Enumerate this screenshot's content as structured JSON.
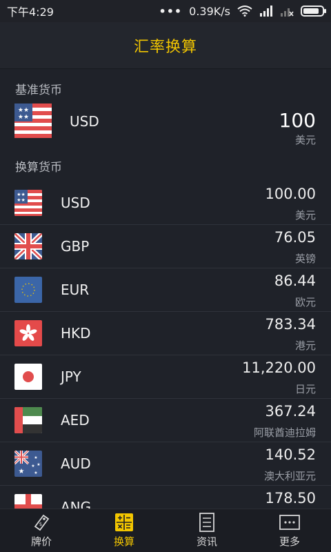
{
  "status": {
    "time": "下午4:29",
    "speed": "0.39K/s"
  },
  "header": {
    "title": "汇率换算"
  },
  "base": {
    "section_label": "基准货币",
    "code": "USD",
    "value": "100",
    "unit": "美元",
    "flag_icon": "us-flag-icon"
  },
  "convert_label": "换算货币",
  "rates": [
    {
      "code": "USD",
      "value": "100.00",
      "unit": "美元",
      "flag_icon": "us-flag-icon"
    },
    {
      "code": "GBP",
      "value": "76.05",
      "unit": "英镑",
      "flag_icon": "uk-flag-icon"
    },
    {
      "code": "EUR",
      "value": "86.44",
      "unit": "欧元",
      "flag_icon": "eu-flag-icon"
    },
    {
      "code": "HKD",
      "value": "783.34",
      "unit": "港元",
      "flag_icon": "hk-flag-icon"
    },
    {
      "code": "JPY",
      "value": "11,220.00",
      "unit": "日元",
      "flag_icon": "jp-flag-icon"
    },
    {
      "code": "AED",
      "value": "367.24",
      "unit": "阿联酋迪拉姆",
      "flag_icon": "ae-flag-icon"
    },
    {
      "code": "AUD",
      "value": "140.52",
      "unit": "澳大利亚元",
      "flag_icon": "au-flag-icon"
    },
    {
      "code": "ANG",
      "value": "178.50",
      "unit": "",
      "flag_icon": "ang-flag-icon"
    }
  ],
  "tabs": [
    {
      "label": "牌价",
      "icon": "price-tag-icon"
    },
    {
      "label": "换算",
      "icon": "calculator-icon",
      "active": true
    },
    {
      "label": "资讯",
      "icon": "news-icon"
    },
    {
      "label": "更多",
      "icon": "more-icon"
    }
  ],
  "colors": {
    "accent": "#f3c600",
    "background": "#1f2229"
  }
}
